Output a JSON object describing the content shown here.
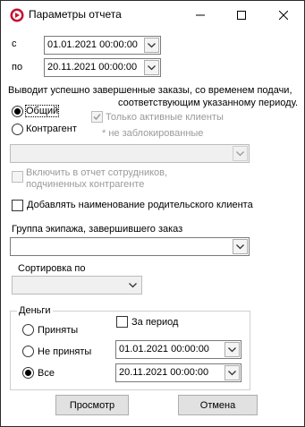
{
  "window": {
    "title": "Параметры отчета"
  },
  "period": {
    "from_label": "с",
    "from_value": "01.01.2021 00:00:00",
    "to_label": "по",
    "to_value": "20.11.2021 00:00:00"
  },
  "description": {
    "line1": "Выводит успешно завершенные заказы, со временем подачи,",
    "line2": "соответствующим указанному периоду."
  },
  "client_type": {
    "option_general": "Общий",
    "option_counterparty": "Контрагент",
    "selected": "Общий"
  },
  "active_only": {
    "label": "Только активные клиенты",
    "checked": true,
    "enabled": false
  },
  "not_blocked_note": "* не заблокированные",
  "counterparty_combo": {
    "value": ""
  },
  "include_employees": {
    "line1": "Включить в отчет сотрудников,",
    "line2": "подчиненных контрагенте",
    "checked": false,
    "enabled": false
  },
  "add_parent_name": {
    "label": "Добавлять наименование родительского клиента",
    "checked": false
  },
  "crew_group": {
    "label": "Группа экипажа, завершившего заказ",
    "value": ""
  },
  "sorting": {
    "label": "Сортировка по",
    "value": ""
  },
  "money": {
    "group_label": "Деньги",
    "accepted": "Приняты",
    "not_accepted": "Не приняты",
    "all": "Все",
    "selected": "Все",
    "for_period_label": "За период",
    "for_period_checked": false,
    "from_value": "01.01.2021 00:00:00",
    "to_value": "20.11.2021 00:00:00"
  },
  "buttons": {
    "preview": "Просмотр",
    "cancel": "Отмена"
  },
  "colors": {
    "accent_icon": "#c8102e",
    "border": "#7a7a7a",
    "button_bg": "#e1e1e1"
  }
}
